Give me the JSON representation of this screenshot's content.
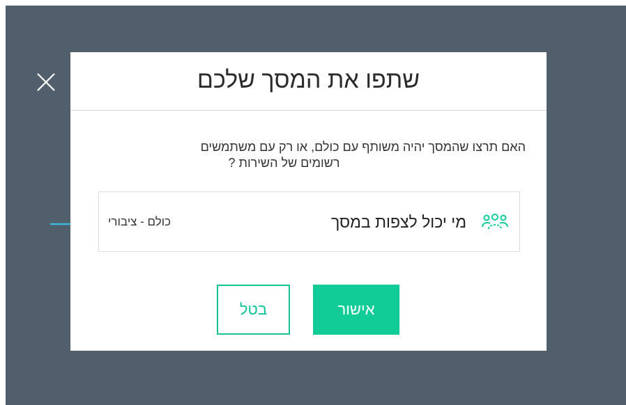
{
  "dialog": {
    "title": "שתפו את המסך שלכם",
    "question_line1": "האם תרצו שהמסך יהיה משותף עם כולם, או רק עם משתמשים",
    "question_line2": "רשומים של השירות ?",
    "visibility": {
      "label": "מי יכול לצפות במסך",
      "value": "כולם - ציבורי",
      "icon": "users-icon"
    },
    "confirm_label": "אישור",
    "cancel_label": "בטל"
  },
  "colors": {
    "backdrop": "#515f6c",
    "accent": "#12cc98",
    "arrow": "#3bb7d6"
  }
}
